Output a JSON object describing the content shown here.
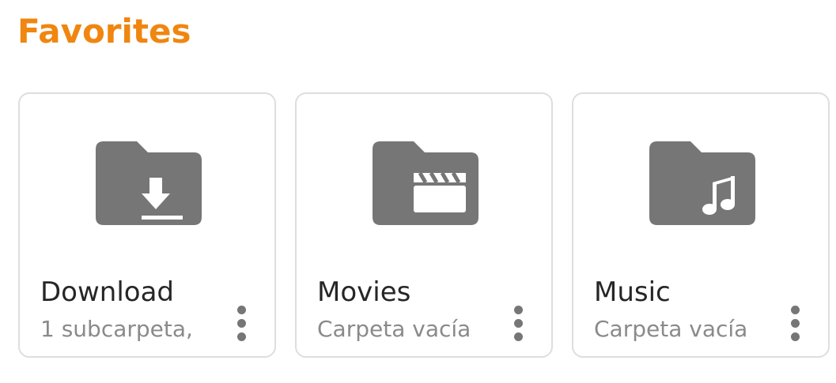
{
  "colors": {
    "accent": "#f0860f",
    "icon": "#767676",
    "name_text": "#262626",
    "sub_text": "#8a8a8a",
    "card_border": "#dedede"
  },
  "favorites": {
    "title": "Favorites",
    "items": [
      {
        "name": "Download",
        "subtitle": "1 subcarpeta,",
        "icon": "folder-download-icon"
      },
      {
        "name": "Movies",
        "subtitle": "Carpeta vacía",
        "icon": "folder-movies-icon"
      },
      {
        "name": "Music",
        "subtitle": "Carpeta vacía",
        "icon": "folder-music-icon"
      }
    ]
  }
}
